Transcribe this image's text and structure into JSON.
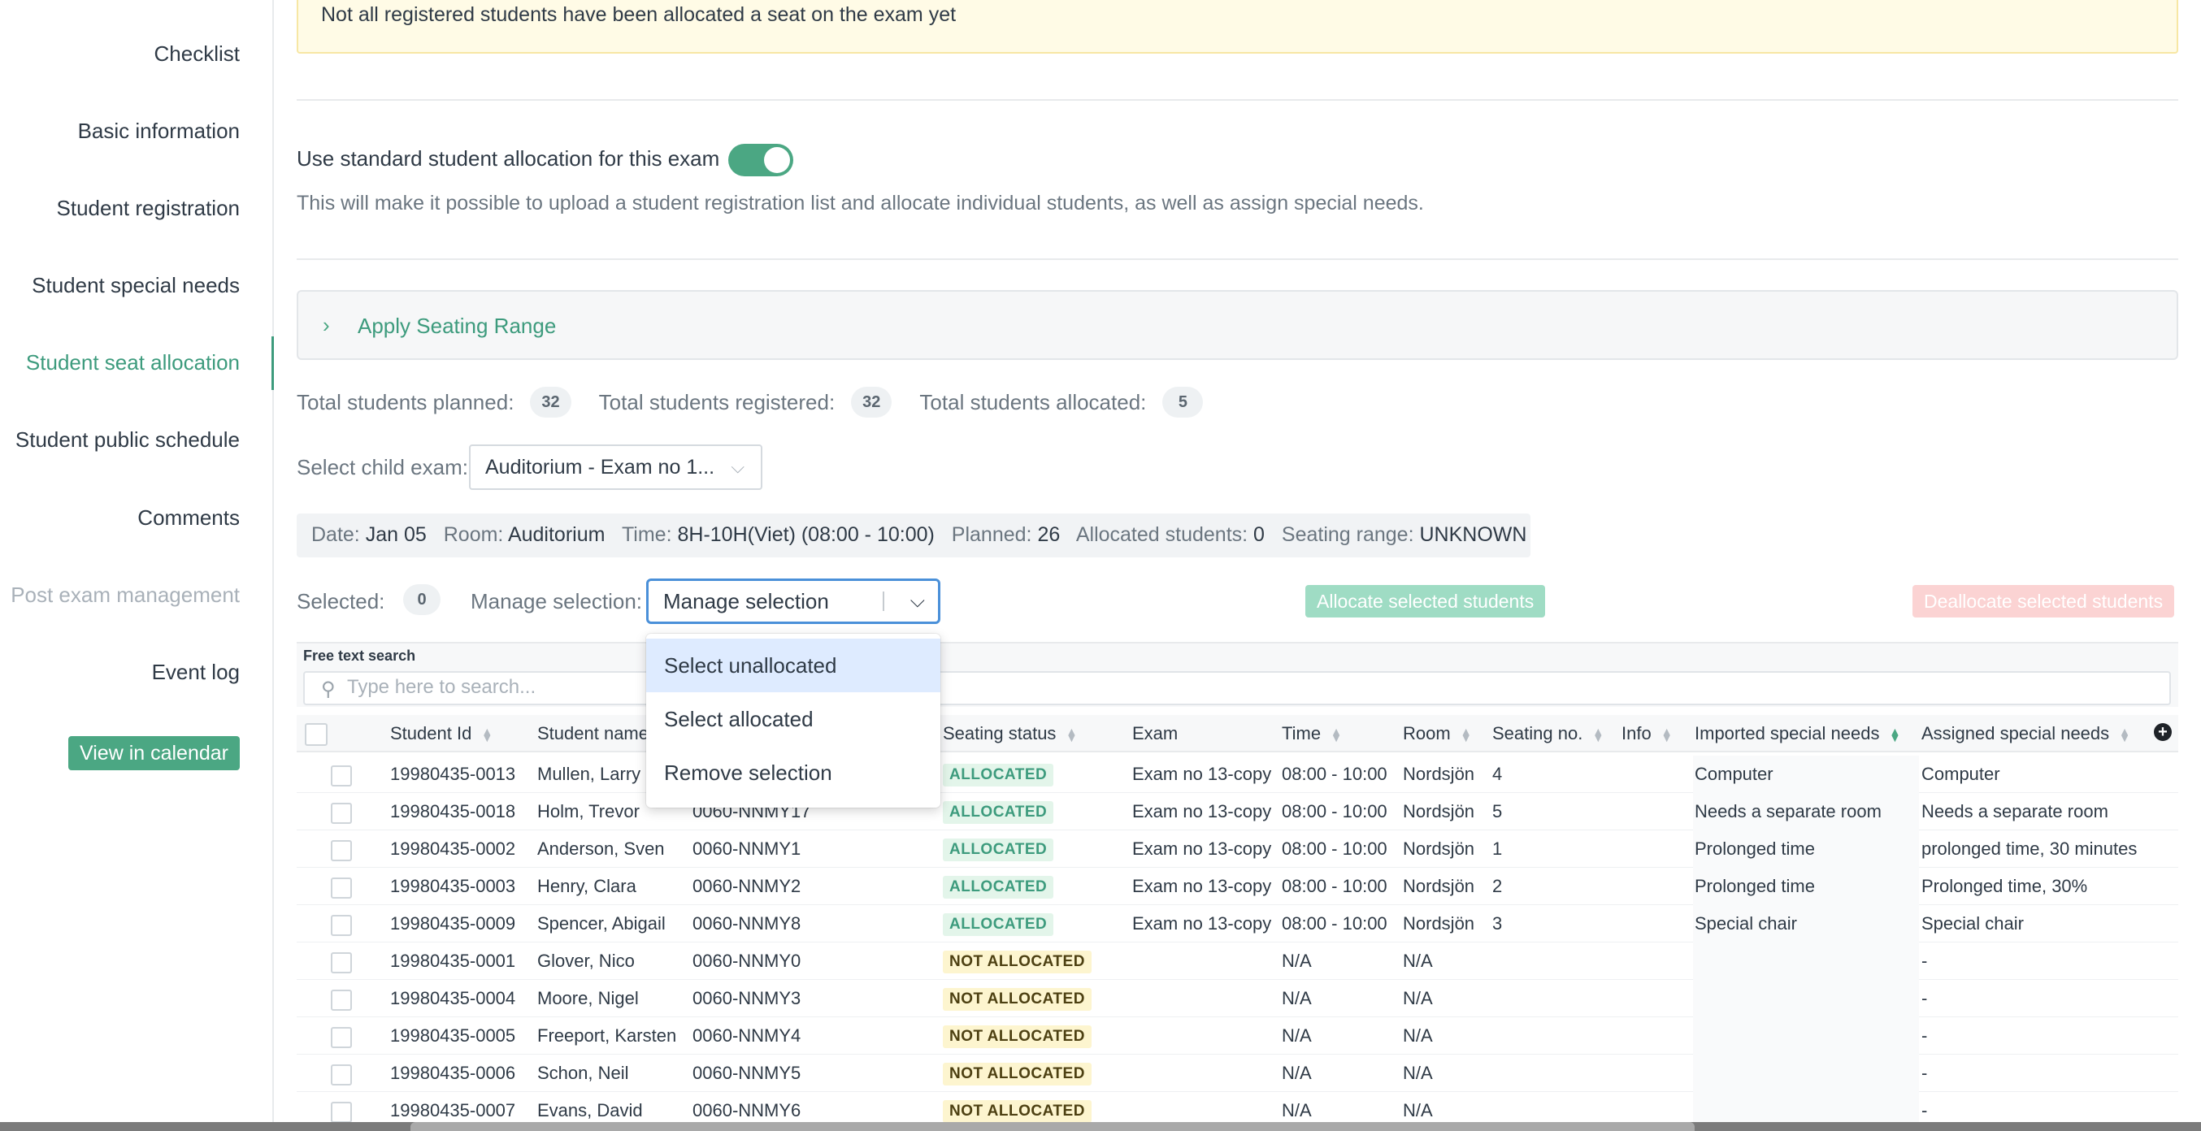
{
  "sidebar": {
    "items": [
      {
        "label": "Checklist"
      },
      {
        "label": "Basic information"
      },
      {
        "label": "Student registration"
      },
      {
        "label": "Student special needs"
      },
      {
        "label": "Student seat allocation"
      },
      {
        "label": "Student public schedule"
      },
      {
        "label": "Comments"
      },
      {
        "label": "Post exam management"
      },
      {
        "label": "Event log"
      }
    ],
    "active_item": "Student seat allocation",
    "calendar_button": "View in calendar"
  },
  "banner": {
    "text": "Not all registered students have been allocated a seat on the exam yet"
  },
  "allocation": {
    "toggle_label": "Use standard student allocation for this exam",
    "toggle_on": true,
    "hint": "This will make it possible to upload a student registration list and allocate individual students, as well as assign special needs."
  },
  "seating_range": {
    "title": "Apply Seating Range"
  },
  "stats": {
    "planned_label": "Total students planned:",
    "planned": "32",
    "registered_label": "Total students registered:",
    "registered": "32",
    "allocated_label": "Total students allocated:",
    "allocated": "5"
  },
  "child_exam": {
    "label": "Select child exam:",
    "value": "Auditorium - Exam no 1..."
  },
  "info": {
    "date_label": "Date:",
    "date": "Jan 05",
    "room_label": "Room:",
    "room": "Auditorium",
    "time_label": "Time:",
    "time": "8H-10H(Viet) (08:00 - 10:00)",
    "planned_label": "Planned:",
    "planned": "26",
    "allocated_label": "Allocated students:",
    "allocated": "0",
    "range_label": "Seating range:",
    "range": "UNKNOWN"
  },
  "selection": {
    "selected_label": "Selected:",
    "selected_count": "0",
    "manage_label": "Manage selection:",
    "manage_value": "Manage selection",
    "options": [
      "Select unallocated",
      "Select allocated",
      "Remove selection"
    ],
    "highlighted_option": "Select unallocated"
  },
  "actions": {
    "allocate": "Allocate selected students",
    "deallocate": "Deallocate selected students"
  },
  "search": {
    "label": "Free text search",
    "placeholder": "Type here to search..."
  },
  "table": {
    "columns": [
      "Student Id",
      "Student name",
      "",
      "Seating status",
      "Exam",
      "Time",
      "Room",
      "Seating no.",
      "Info",
      "Imported special needs",
      "Assigned special needs"
    ],
    "rows": [
      {
        "id": "19980435-0013",
        "name": "Mullen, Larry",
        "code": "",
        "status": "ALLOCATED",
        "exam": "Exam no 13-copy",
        "time": "08:00 - 10:00",
        "room": "Nordsjön",
        "seat": "4",
        "info": "",
        "imported": "Computer",
        "assigned": "Computer"
      },
      {
        "id": "19980435-0018",
        "name": "Holm, Trevor",
        "code": "0060-NNMY17",
        "status": "ALLOCATED",
        "exam": "Exam no 13-copy",
        "time": "08:00 - 10:00",
        "room": "Nordsjön",
        "seat": "5",
        "info": "",
        "imported": "Needs a separate room",
        "assigned": "Needs a separate room"
      },
      {
        "id": "19980435-0002",
        "name": "Anderson, Sven",
        "code": "0060-NNMY1",
        "status": "ALLOCATED",
        "exam": "Exam no 13-copy",
        "time": "08:00 - 10:00",
        "room": "Nordsjön",
        "seat": "1",
        "info": "",
        "imported": "Prolonged time",
        "assigned": "prolonged time, 30 minutes"
      },
      {
        "id": "19980435-0003",
        "name": "Henry, Clara",
        "code": "0060-NNMY2",
        "status": "ALLOCATED",
        "exam": "Exam no 13-copy",
        "time": "08:00 - 10:00",
        "room": "Nordsjön",
        "seat": "2",
        "info": "",
        "imported": "Prolonged time",
        "assigned": "Prolonged time, 30%"
      },
      {
        "id": "19980435-0009",
        "name": "Spencer, Abigail",
        "code": "0060-NNMY8",
        "status": "ALLOCATED",
        "exam": "Exam no 13-copy",
        "time": "08:00 - 10:00",
        "room": "Nordsjön",
        "seat": "3",
        "info": "",
        "imported": "Special chair",
        "assigned": "Special chair"
      },
      {
        "id": "19980435-0001",
        "name": "Glover, Nico",
        "code": "0060-NNMY0",
        "status": "NOT ALLOCATED",
        "exam": "",
        "time": "N/A",
        "room": "N/A",
        "seat": "",
        "info": "",
        "imported": "",
        "assigned": "-"
      },
      {
        "id": "19980435-0004",
        "name": "Moore, Nigel",
        "code": "0060-NNMY3",
        "status": "NOT ALLOCATED",
        "exam": "",
        "time": "N/A",
        "room": "N/A",
        "seat": "",
        "info": "",
        "imported": "",
        "assigned": "-"
      },
      {
        "id": "19980435-0005",
        "name": "Freeport, Karsten",
        "code": "0060-NNMY4",
        "status": "NOT ALLOCATED",
        "exam": "",
        "time": "N/A",
        "room": "N/A",
        "seat": "",
        "info": "",
        "imported": "",
        "assigned": "-"
      },
      {
        "id": "19980435-0006",
        "name": "Schon, Neil",
        "code": "0060-NNMY5",
        "status": "NOT ALLOCATED",
        "exam": "",
        "time": "N/A",
        "room": "N/A",
        "seat": "",
        "info": "",
        "imported": "",
        "assigned": "-"
      },
      {
        "id": "19980435-0007",
        "name": "Evans, David",
        "code": "0060-NNMY6",
        "status": "NOT ALLOCATED",
        "exam": "",
        "time": "N/A",
        "room": "N/A",
        "seat": "",
        "info": "",
        "imported": "",
        "assigned": "-"
      }
    ]
  },
  "icons": {
    "search": "search-icon",
    "chevron_right": "chevron-right-icon",
    "chevron_down": "chevron-down-icon",
    "add_column": "plus-circle-icon",
    "sort": "sort-icon"
  },
  "colors": {
    "accent": "#4ba783",
    "banner_bg": "#fffbe6",
    "allocated_badge": "#e3f5ea",
    "not_allocated_badge": "#fdf5cf",
    "focus_border": "#4a90d9"
  }
}
